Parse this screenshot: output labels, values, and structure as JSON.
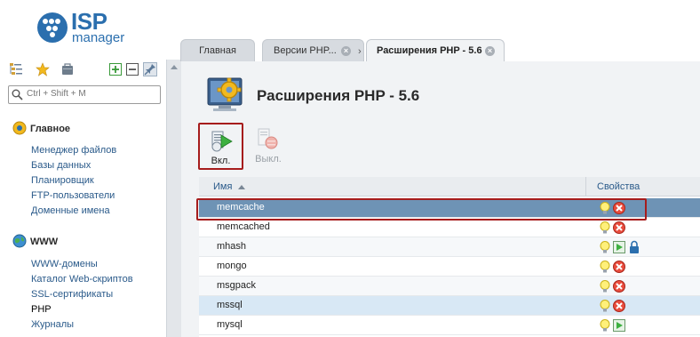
{
  "logo": {
    "brand": "ISP",
    "product": "manager"
  },
  "search": {
    "placeholder": "Ctrl + Shift + M"
  },
  "nav": {
    "groups": [
      {
        "title": "Главное",
        "items": [
          "Менеджер файлов",
          "Базы данных",
          "Планировщик",
          "FTP-пользователи",
          "Доменные имена"
        ]
      },
      {
        "title": "WWW",
        "items": [
          "WWW-домены",
          "Каталог Web-скриптов",
          "SSL-сертификаты",
          "PHP",
          "Журналы"
        ]
      }
    ],
    "active_item": "PHP"
  },
  "tabs": [
    {
      "label": "Главная",
      "closable": false,
      "active": false
    },
    {
      "label": "Версии PHP...",
      "closable": true,
      "active": false
    },
    {
      "label": "Расширения PHP - 5.6",
      "closable": true,
      "active": true
    }
  ],
  "page": {
    "title": "Расширения PHP - 5.6"
  },
  "toolbar": {
    "enable_label": "Вкл.",
    "disable_label": "Выкл."
  },
  "table": {
    "columns": [
      "Имя",
      "Свойства"
    ],
    "rows": [
      {
        "name": "memcache",
        "status": [
          "bulb-icon",
          "disabled-icon"
        ],
        "selected": true
      },
      {
        "name": "memcached",
        "status": [
          "bulb-icon",
          "disabled-icon"
        ]
      },
      {
        "name": "mhash",
        "status": [
          "bulb-icon",
          "enabled-icon",
          "lock-icon"
        ]
      },
      {
        "name": "mongo",
        "status": [
          "bulb-icon",
          "disabled-icon"
        ]
      },
      {
        "name": "msgpack",
        "status": [
          "bulb-icon",
          "disabled-icon"
        ]
      },
      {
        "name": "mssql",
        "status": [
          "bulb-icon",
          "disabled-icon"
        ],
        "hover": true
      },
      {
        "name": "mysql",
        "status": [
          "bulb-icon",
          "enabled-icon"
        ]
      }
    ]
  },
  "colors": {
    "accent": "#2b6fae",
    "selected_row": "#6e93b5",
    "highlight_frame": "#a61c1c"
  }
}
